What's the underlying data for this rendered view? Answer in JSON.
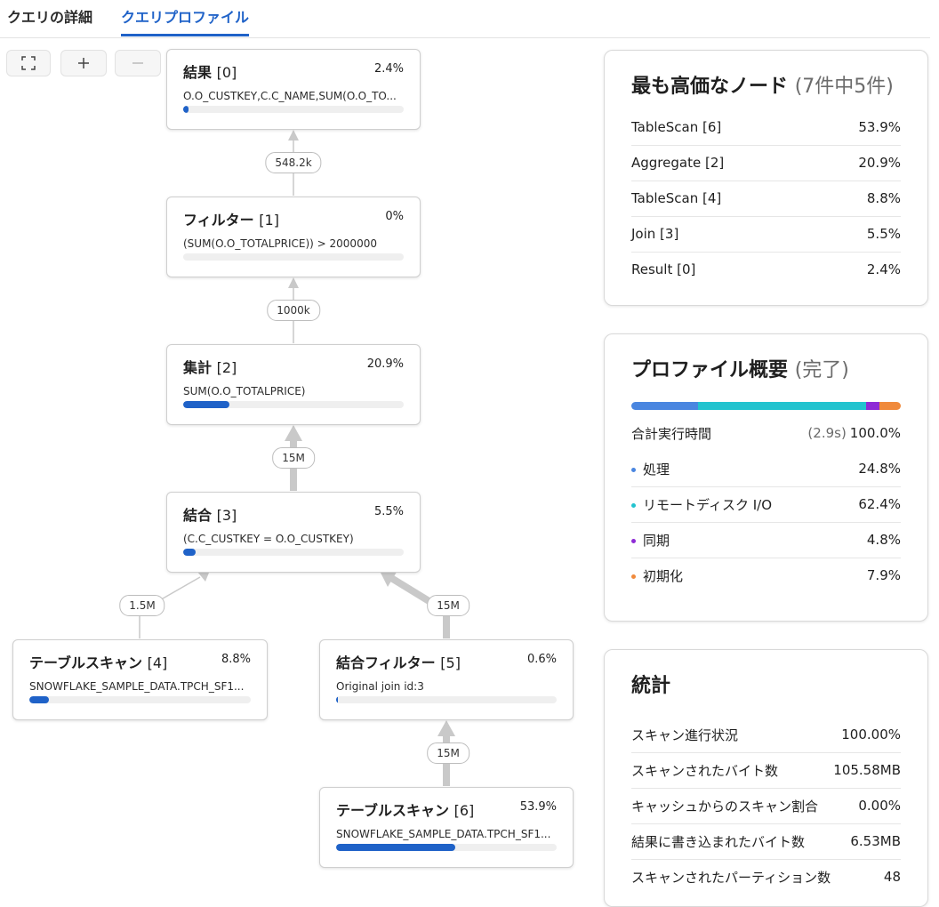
{
  "tabs": [
    {
      "label": "クエリの詳細",
      "active": false
    },
    {
      "label": "クエリプロファイル",
      "active": true
    }
  ],
  "toolbar": {
    "fit_icon": "fit-screen-icon",
    "zoom_in_icon": "plus-icon",
    "zoom_out_icon": "minus-icon"
  },
  "nodes": {
    "result": {
      "name": "結果",
      "index": "[0]",
      "pct": "2.4%",
      "detail": "O.O_CUSTKEY,C.C_NAME,SUM(O.O_TO...",
      "fill": 0.024
    },
    "filter": {
      "name": "フィルター",
      "index": "[1]",
      "pct": "0%",
      "detail": "(SUM(O.O_TOTALPRICE)) > 2000000",
      "fill": 0
    },
    "aggregate": {
      "name": "集計",
      "index": "[2]",
      "pct": "20.9%",
      "detail": "SUM(O.O_TOTALPRICE)",
      "fill": 0.209
    },
    "join": {
      "name": "結合",
      "index": "[3]",
      "pct": "5.5%",
      "detail": "(C.C_CUSTKEY = O.O_CUSTKEY)",
      "fill": 0.055
    },
    "tablescan4": {
      "name": "テーブルスキャン",
      "index": "[4]",
      "pct": "8.8%",
      "detail": "SNOWFLAKE_SAMPLE_DATA.TPCH_SF1...",
      "fill": 0.088
    },
    "joinfilter": {
      "name": "結合フィルター",
      "index": "[5]",
      "pct": "0.6%",
      "detail": "Original join id:3",
      "fill": 0.006
    },
    "tablescan6": {
      "name": "テーブルスキャン",
      "index": "[6]",
      "pct": "53.9%",
      "detail": "SNOWFLAKE_SAMPLE_DATA.TPCH_SF1...",
      "fill": 0.539
    }
  },
  "edges": {
    "filter_to_result": "548.2k",
    "aggregate_to_filter": "1000k",
    "join_to_aggregate": "15M",
    "ts4_to_join": "1.5M",
    "joinfilter_to_join": "15M",
    "ts6_to_joinfilter": "15M"
  },
  "expensive": {
    "title": "最も高価なノード",
    "subtitle": "(7件中5件)",
    "rows": [
      {
        "label": "TableScan [6]",
        "value": "53.9%"
      },
      {
        "label": "Aggregate [2]",
        "value": "20.9%"
      },
      {
        "label": "TableScan [4]",
        "value": "8.8%"
      },
      {
        "label": "Join [3]",
        "value": "5.5%"
      },
      {
        "label": "Result [0]",
        "value": "2.4%"
      }
    ]
  },
  "profile": {
    "title": "プロファイル概要",
    "subtitle": "(完了)",
    "total_label": "合計実行時間",
    "total_time": "(2.9s)",
    "total_pct": "100.0%",
    "rows": [
      {
        "label": "処理",
        "value": "24.8%",
        "color": "#4a86e0",
        "share": 0.248
      },
      {
        "label": "リモートディスク I/O",
        "value": "62.4%",
        "color": "#22c3cf",
        "share": 0.624
      },
      {
        "label": "同期",
        "value": "4.8%",
        "color": "#8e2bd6",
        "share": 0.048
      },
      {
        "label": "初期化",
        "value": "7.9%",
        "color": "#f08a3c",
        "share": 0.079
      }
    ]
  },
  "stats": {
    "title": "統計",
    "rows": [
      {
        "label": "スキャン進行状況",
        "value": "100.00%"
      },
      {
        "label": "スキャンされたバイト数",
        "value": "105.58MB"
      },
      {
        "label": "キャッシュからのスキャン割合",
        "value": "0.00%"
      },
      {
        "label": "結果に書き込まれたバイト数",
        "value": "6.53MB"
      },
      {
        "label": "スキャンされたパーティション数",
        "value": "48"
      }
    ]
  }
}
